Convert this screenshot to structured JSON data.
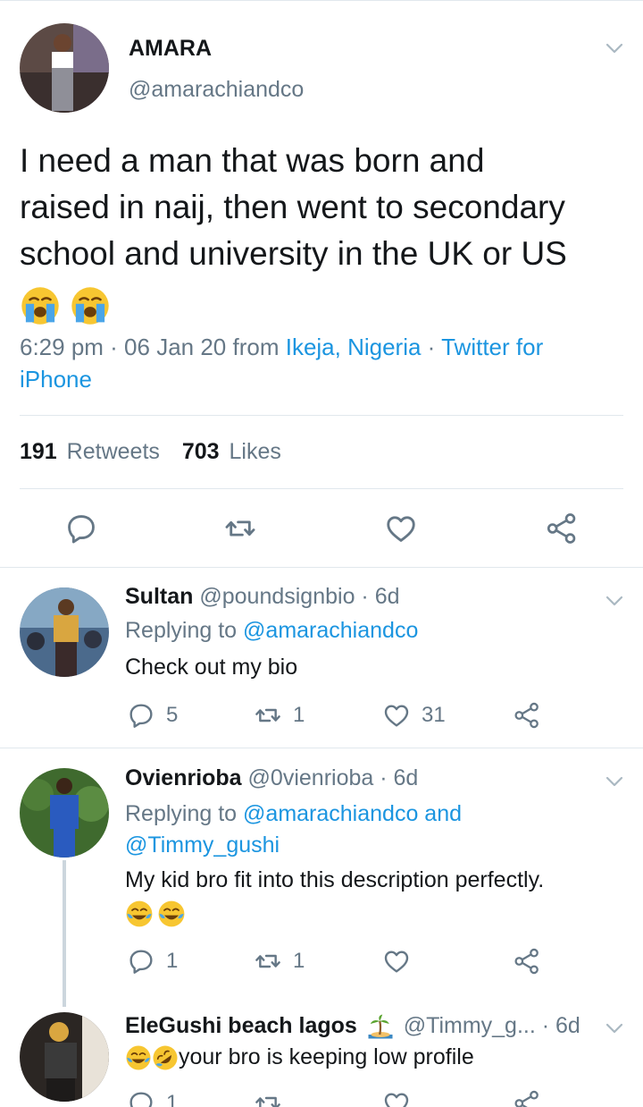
{
  "main_tweet": {
    "author_name": "AMARA",
    "author_handle": "@amarachiandco",
    "text_line1": "I need a man that was born and",
    "text_line2": "raised in naij, then went to secondary",
    "text_line3": "school and university in the UK or US",
    "time_prefix": "6:29 pm · 06 Jan 20 from ",
    "location": "Ikeja, Nigeria",
    "separator": " · ",
    "source_part1": "Twitter for",
    "source_part2": "iPhone",
    "retweet_count": "191",
    "retweets_label": "Retweets",
    "like_count": "703",
    "likes_label": "Likes"
  },
  "replies": [
    {
      "name": "Sultan",
      "handle": "@poundsignbio",
      "age": " · 6d",
      "replying_prefix": "Replying to ",
      "replying_to": "@amarachiandco",
      "text": "Check out my bio",
      "reply_count": "5",
      "retweet_count": "1",
      "like_count": "31"
    },
    {
      "name": "Ovienrioba",
      "handle": "@0vienrioba",
      "age": " · 6d",
      "replying_prefix": "Replying to ",
      "replying_to": "@amarachiandco",
      "replying_and": " and",
      "replying_to_2": "@Timmy_gushi",
      "text": "My kid bro fit into this description perfectly.",
      "reply_count": "1",
      "retweet_count": "1"
    },
    {
      "name": "EleGushi beach lagos",
      "handle": "@Timmy_g...",
      "age": " · 6d",
      "text": "your bro is keeping low profile",
      "reply_count": "1"
    }
  ],
  "colors": {
    "link": "#1b95e0",
    "muted": "#657786",
    "divider": "#e1e8ed"
  },
  "icons": [
    "chevron-down-icon",
    "reply-icon",
    "retweet-icon",
    "like-icon",
    "share-icon",
    "loudly-crying-emoji",
    "tears-of-joy-emoji",
    "rolling-laughing-emoji",
    "island-emoji"
  ]
}
